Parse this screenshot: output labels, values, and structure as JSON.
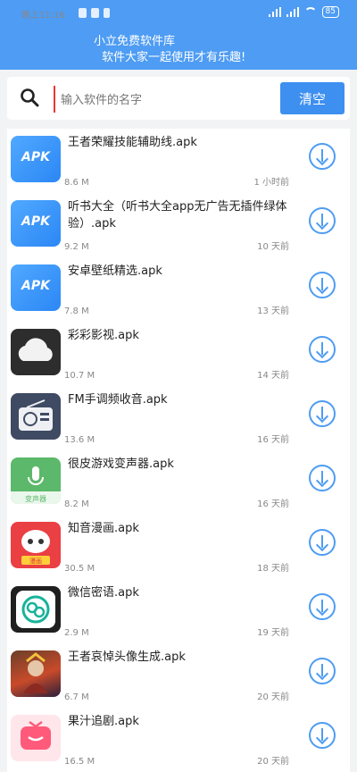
{
  "status_bar": {
    "time": "晚上11:16",
    "battery": "85"
  },
  "header": {
    "title_line1": "小立免费软件库",
    "title_line2": "软件大家一起使用才有乐趣!"
  },
  "search": {
    "placeholder": "输入软件的名字",
    "clear_label": "清空"
  },
  "apps": [
    {
      "name": "王者荣耀技能辅助线.apk",
      "size": "8.6 M",
      "time": "1 小时前",
      "icon": "apk",
      "icon_text": "APK"
    },
    {
      "name": "听书大全（听书大全app无广告无插件绿体验）.apk",
      "size": "9.2 M",
      "time": "10 天前",
      "icon": "apk",
      "icon_text": "APK"
    },
    {
      "name": "安卓壁纸精选.apk",
      "size": "7.8 M",
      "time": "13 天前",
      "icon": "apk",
      "icon_text": "APK"
    },
    {
      "name": "彩彩影视.apk",
      "size": "10.7 M",
      "time": "14 天前",
      "icon": "cloud"
    },
    {
      "name": "FM手调频收音.apk",
      "size": "13.6 M",
      "time": "16 天前",
      "icon": "radio"
    },
    {
      "name": "很皮游戏变声器.apk",
      "size": "8.2 M",
      "time": "16 天前",
      "icon": "mic",
      "icon_text": "变声器"
    },
    {
      "name": "知音漫画.apk",
      "size": "30.5 M",
      "time": "18 天前",
      "icon": "manga",
      "icon_text": "漫画"
    },
    {
      "name": "微信密语.apk",
      "size": "2.9 M",
      "time": "19 天前",
      "icon": "wechat"
    },
    {
      "name": "王者哀悼头像生成.apk",
      "size": "6.7 M",
      "time": "20 天前",
      "icon": "avatar"
    },
    {
      "name": "果汁追剧.apk",
      "size": "16.5 M",
      "time": "20 天前",
      "icon": "tv"
    }
  ],
  "colors": {
    "header": "#4e9cf3",
    "accent": "#3d8ff0",
    "icon_apk": "#2b87f5"
  }
}
